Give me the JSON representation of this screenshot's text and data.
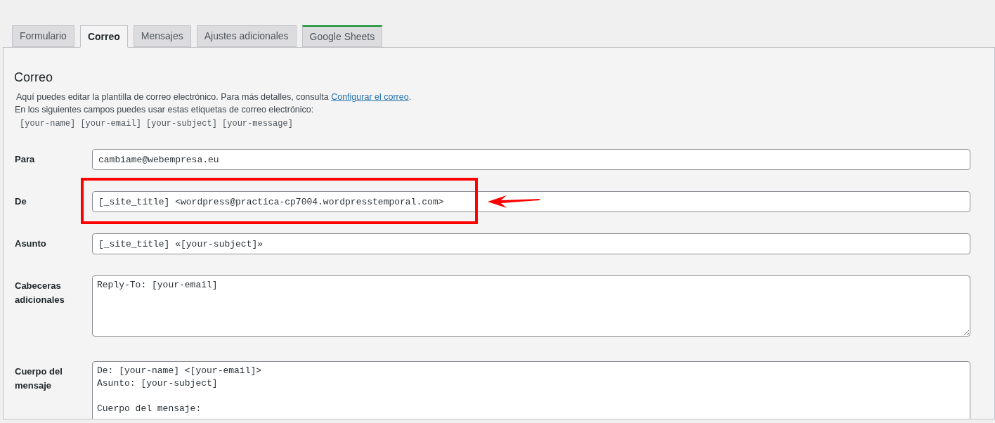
{
  "tabs": [
    {
      "label": "Formulario",
      "selected": false
    },
    {
      "label": "Correo",
      "selected": true
    },
    {
      "label": "Mensajes",
      "selected": false
    },
    {
      "label": "Ajustes adicionales",
      "selected": false
    },
    {
      "label": "Google Sheets",
      "selected": false,
      "color": "#008a20"
    }
  ],
  "panel": {
    "heading": "Correo",
    "intro": "Aquí puedes editar la plantilla de correo electrónico. Para más detalles, consulta ",
    "intro_link": "Configurar el correo",
    "intro_end": ".",
    "tags_note": "En los siguientes campos puedes usar estas etiquetas de correo electrónico:",
    "tags": "[your-name] [your-email] [your-subject] [your-message]",
    "fields": [
      {
        "kind": "input",
        "label": "Para",
        "value": "cambiame@webempresa.eu",
        "highlighted": false
      },
      {
        "kind": "input",
        "label": "De",
        "value": "[_site_title] <wordpress@practica-cp7004.wordpresstemporal.com>",
        "highlighted": true
      },
      {
        "kind": "input",
        "label": "Asunto",
        "value": "[_site_title] «[your-subject]»",
        "highlighted": false
      },
      {
        "kind": "textarea",
        "label": "Cabeceras adicionales",
        "value": "Reply-To: [your-email]",
        "highlighted": false
      },
      {
        "kind": "textarea",
        "label": "Cuerpo del mensaje",
        "value": "De: [your-name] <[your-email]>\nAsunto: [your-subject]\n\nCuerpo del mensaje:",
        "highlighted": false
      }
    ]
  }
}
